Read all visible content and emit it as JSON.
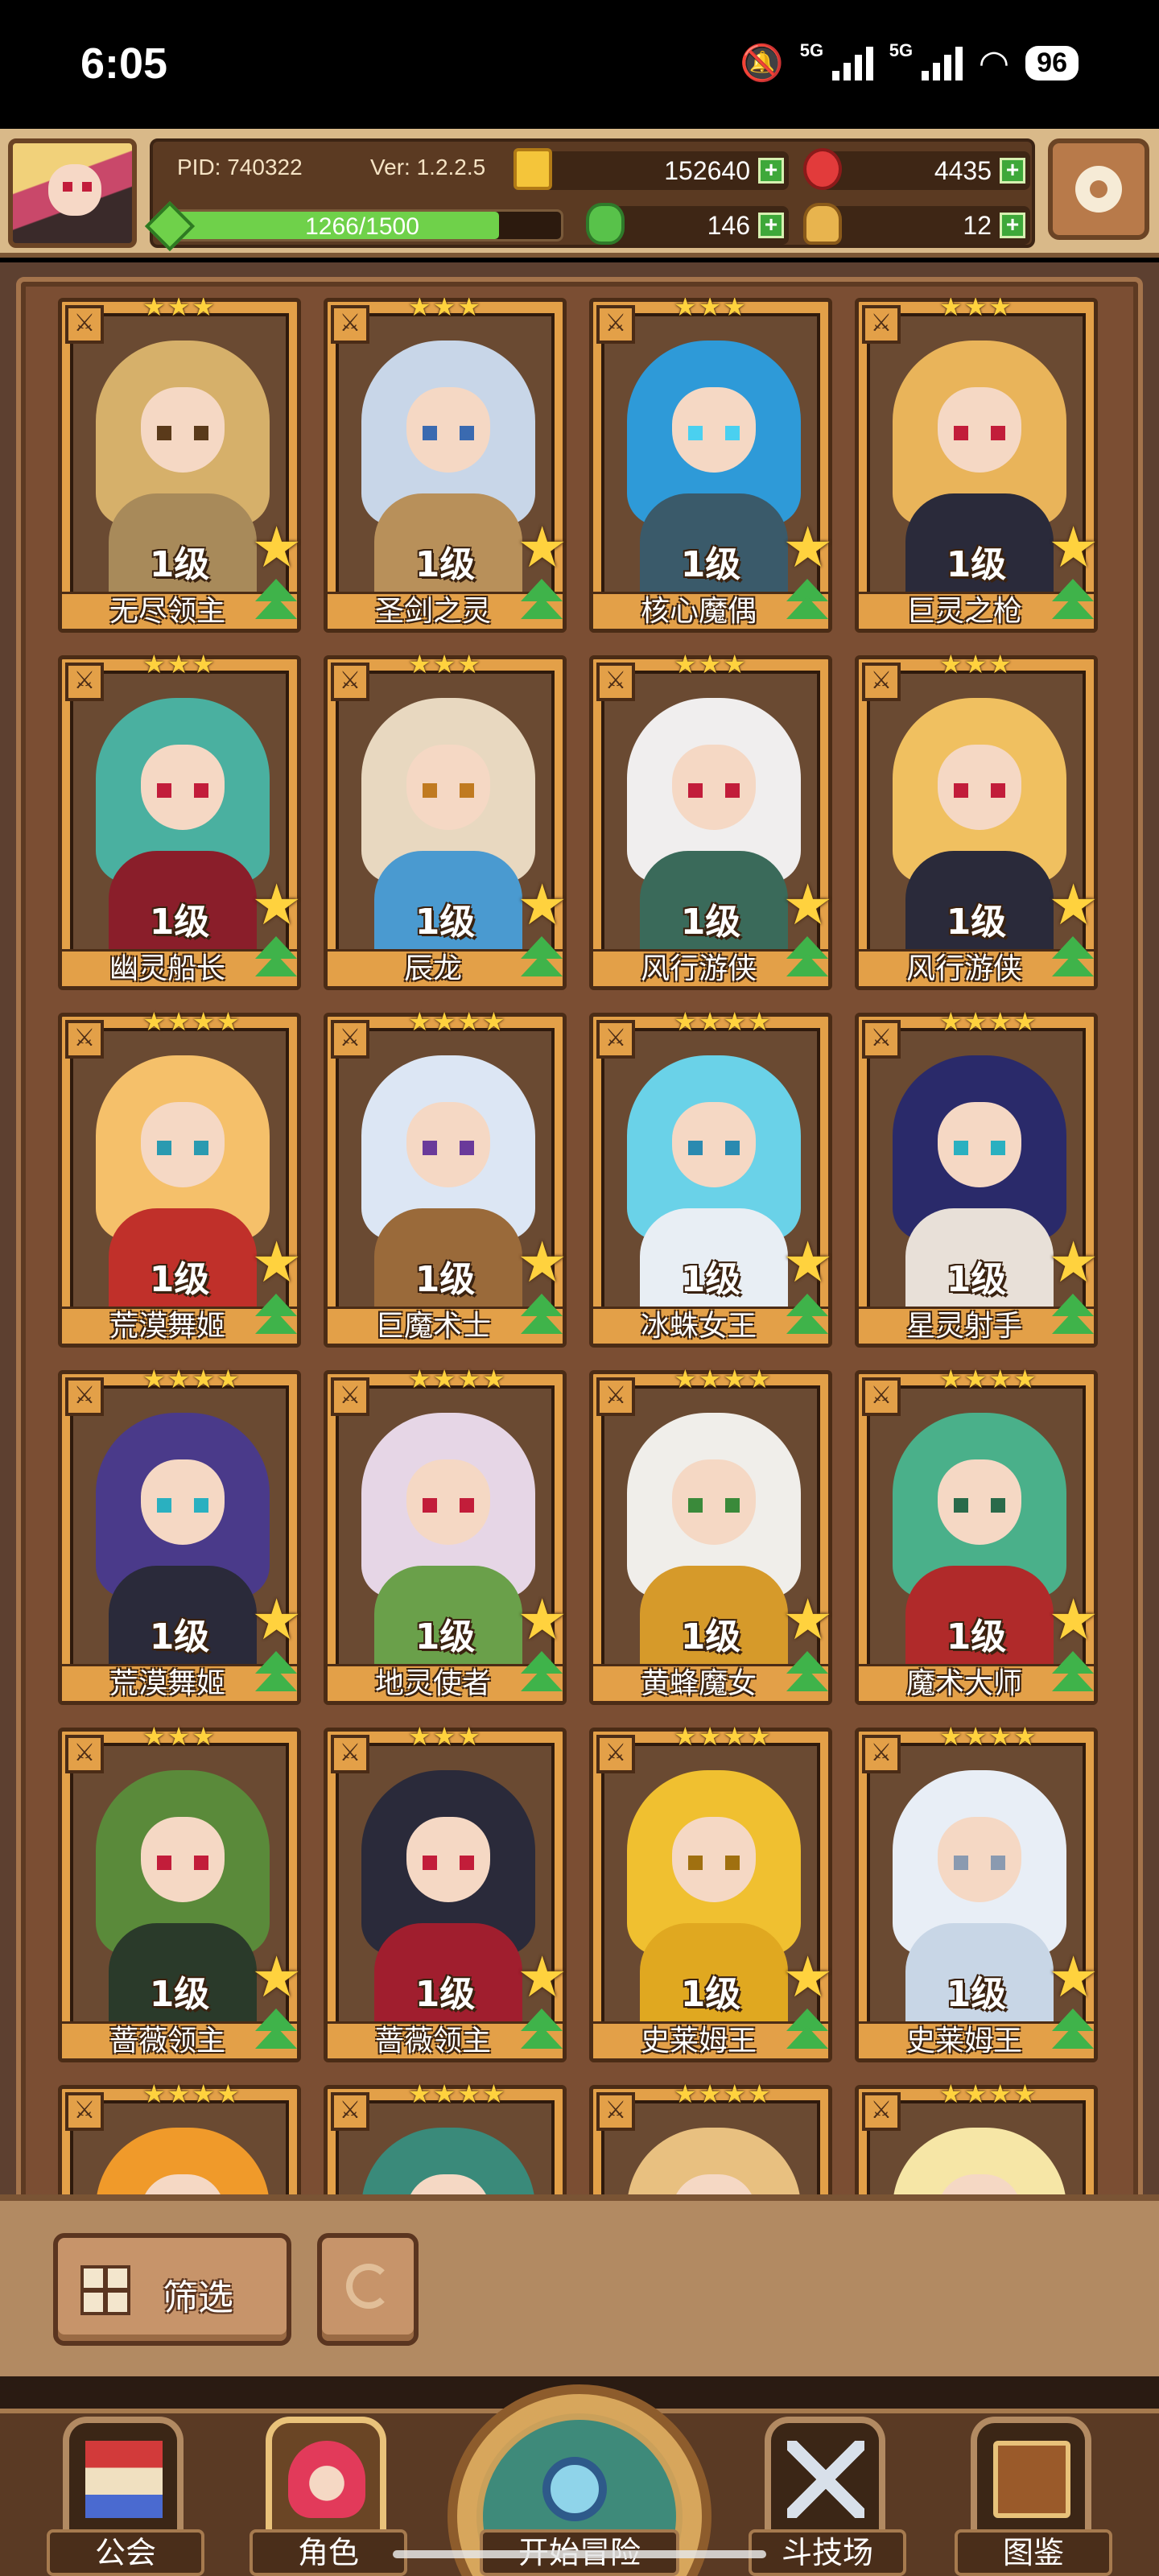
{
  "status_bar": {
    "time": "6:05",
    "signal1": "5G",
    "signal2": "5G",
    "battery": "96"
  },
  "header": {
    "pid": "PID: 740322",
    "version": "Ver: 1.2.2.5",
    "gold": "152640",
    "ruby": "4435",
    "clover": "146",
    "bread": "12",
    "xp_text": "1266/1500",
    "xp_fraction": 0.844
  },
  "cards": [
    {
      "name": "无尽领主",
      "level": "1级",
      "stars": 3,
      "hair": "#d6b06a",
      "body": "#a88a5a",
      "eye": "#5a3a1a"
    },
    {
      "name": "圣剑之灵",
      "level": "1级",
      "stars": 3,
      "hair": "#c8d6e8",
      "body": "#b8905a",
      "eye": "#3a6ab0"
    },
    {
      "name": "核心魔偶",
      "level": "1级",
      "stars": 3,
      "hair": "#2e9ad8",
      "body": "#3a5a6a",
      "eye": "#4ad0f0"
    },
    {
      "name": "巨灵之枪",
      "level": "1级",
      "stars": 3,
      "hair": "#e9b45a",
      "body": "#2a2a3a",
      "eye": "#c21d3a"
    },
    {
      "name": "幽灵船长",
      "level": "1级",
      "stars": 3,
      "hair": "#4ab0a0",
      "body": "#8a1e2a",
      "eye": "#c21d3a"
    },
    {
      "name": "辰龙",
      "level": "1级",
      "stars": 3,
      "hair": "#e8d8c0",
      "body": "#4a9ad0",
      "eye": "#c07a20"
    },
    {
      "name": "风行游侠",
      "level": "1级",
      "stars": 3,
      "hair": "#f0eeee",
      "body": "#3a6a5a",
      "eye": "#c21d3a"
    },
    {
      "name": "风行游侠",
      "level": "1级",
      "stars": 3,
      "hair": "#f0c060",
      "body": "#2a2a3a",
      "eye": "#c21d3a"
    },
    {
      "name": "荒漠舞姬",
      "level": "1级",
      "stars": 4,
      "hair": "#f5c06a",
      "body": "#c0302a",
      "eye": "#2a9ab0"
    },
    {
      "name": "巨魔术士",
      "level": "1级",
      "stars": 4,
      "hair": "#dce6f4",
      "body": "#9a6a3a",
      "eye": "#6a3a9a"
    },
    {
      "name": "冰蛛女王",
      "level": "1级",
      "stars": 4,
      "hair": "#6ad2e8",
      "body": "#e8eef4",
      "eye": "#2a8ab0"
    },
    {
      "name": "星灵射手",
      "level": "1级",
      "stars": 4,
      "hair": "#2a2a6a",
      "body": "#e8e0d8",
      "eye": "#2ab0c0"
    },
    {
      "name": "荒漠舞姬",
      "level": "1级",
      "stars": 4,
      "hair": "#4a3a8a",
      "body": "#2a2a3a",
      "eye": "#2ab0c0"
    },
    {
      "name": "地灵使者",
      "level": "1级",
      "stars": 4,
      "hair": "#e6d6e6",
      "body": "#6aa04a",
      "eye": "#c21d3a"
    },
    {
      "name": "黄蜂魔女",
      "level": "1级",
      "stars": 4,
      "hair": "#f0eeea",
      "body": "#d69a2a",
      "eye": "#3a8a3a"
    },
    {
      "name": "魔术大师",
      "level": "1级",
      "stars": 4,
      "hair": "#4ab08a",
      "body": "#b02a2a",
      "eye": "#2a6a4a"
    },
    {
      "name": "蔷薇领主",
      "level": "1级",
      "stars": 3,
      "hair": "#5a8a3a",
      "body": "#2a3a2a",
      "eye": "#c21d3a"
    },
    {
      "name": "蔷薇领主",
      "level": "1级",
      "stars": 3,
      "hair": "#2a2a3a",
      "body": "#a01e2e",
      "eye": "#c21d3a"
    },
    {
      "name": "史莱姆王",
      "level": "1级",
      "stars": 4,
      "hair": "#f0c030",
      "body": "#e0a820",
      "eye": "#a07010"
    },
    {
      "name": "史莱姆王",
      "level": "1级",
      "stars": 4,
      "hair": "#e8eef6",
      "body": "#c8d6e6",
      "eye": "#8a9ab0"
    },
    {
      "name": "",
      "level": "",
      "stars": 4,
      "hair": "#f09a2a",
      "body": "#d0602a",
      "eye": "#c21d3a"
    },
    {
      "name": "",
      "level": "",
      "stars": 4,
      "hair": "#3a8a7a",
      "body": "#2a4a4a",
      "eye": "#c21d3a"
    },
    {
      "name": "",
      "level": "",
      "stars": 4,
      "hair": "#e8c080",
      "body": "#c89a5a",
      "eye": "#3a2a1a"
    },
    {
      "name": "",
      "level": "",
      "stars": 4,
      "hair": "#f6e6a6",
      "body": "#f0e8f0",
      "eye": "#c21d3a"
    }
  ],
  "toolbar": {
    "filter_label": "筛选"
  },
  "nav": [
    {
      "label": "公会"
    },
    {
      "label": "角色"
    },
    {
      "label": "开始冒险"
    },
    {
      "label": "斗技场"
    },
    {
      "label": "图鉴"
    }
  ]
}
